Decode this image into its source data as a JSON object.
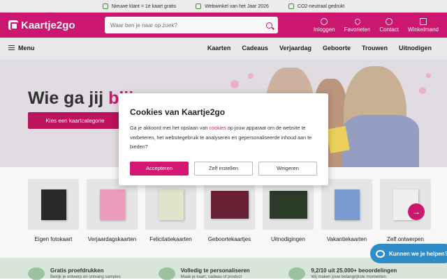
{
  "topbar": {
    "usps": [
      "Nieuwe klant = 1e kaart gratis",
      "Webwinkel van het Jaar 2026",
      "CO2-neutraal gedrukt"
    ]
  },
  "header": {
    "logo": "Kaartje2go",
    "search_placeholder": "Waar ben je naar op zoek?",
    "nav": [
      {
        "label": "Inloggen",
        "icon": "user-icon"
      },
      {
        "label": "Favorieten",
        "icon": "heart-icon"
      },
      {
        "label": "Contact",
        "icon": "headset-icon"
      },
      {
        "label": "Winkelmand",
        "icon": "cart-icon"
      }
    ]
  },
  "menu": {
    "label": "Menu",
    "links": [
      "Kaarten",
      "Cadeaus",
      "Verjaardag",
      "Geboorte",
      "Trouwen",
      "Uitnodigen"
    ]
  },
  "hero": {
    "title_start": "Wie ga jij ",
    "title_highlight": "blij",
    "cta": "Kies een kaartcategorie"
  },
  "categories": [
    {
      "label": "Eigen fotokaart",
      "color": "#2b2b2b"
    },
    {
      "label": "Verjaardagskaarten",
      "color": "#f2a2c0"
    },
    {
      "label": "Felicitatiekaarten",
      "color": "#e9ecd2"
    },
    {
      "label": "Geboortekaartjes",
      "color": "#6e2236"
    },
    {
      "label": "Uitnodigingen",
      "color": "#2c3d2a"
    },
    {
      "label": "Vakantiekaarten",
      "color": "#7ea0d6"
    },
    {
      "label": "Zelf ontwerpen",
      "color": "#f7f7f7"
    }
  ],
  "usps": [
    {
      "title": "Gratis proefdrukken",
      "sub": "Bekijk je ontwerp en ontvang samples"
    },
    {
      "title": "Volledig te personaliseren",
      "sub": "Maak je kaart, cadeau of product"
    },
    {
      "title": "9,2/10 uit 25.000+ beoordelingen",
      "sub": "Wij maken jouw belangrijkste momenten"
    }
  ],
  "cookie": {
    "title": "Cookies van Kaartje2go",
    "text_before": "Ga je akkoord met het opslaan van ",
    "link": "cookies",
    "text_after": " op jouw apparaat om de website te verbeteren, het websitegebruik te analyseren en gepersonaliseerde inhoud aan te bieden?",
    "accept": "Accepteren",
    "settings": "Zelf instellen",
    "decline": "Weigeren"
  },
  "chat": {
    "label": "Kunnen we je helpen?"
  },
  "colors": {
    "brand": "#d21873",
    "chat": "#2e8cc8"
  }
}
